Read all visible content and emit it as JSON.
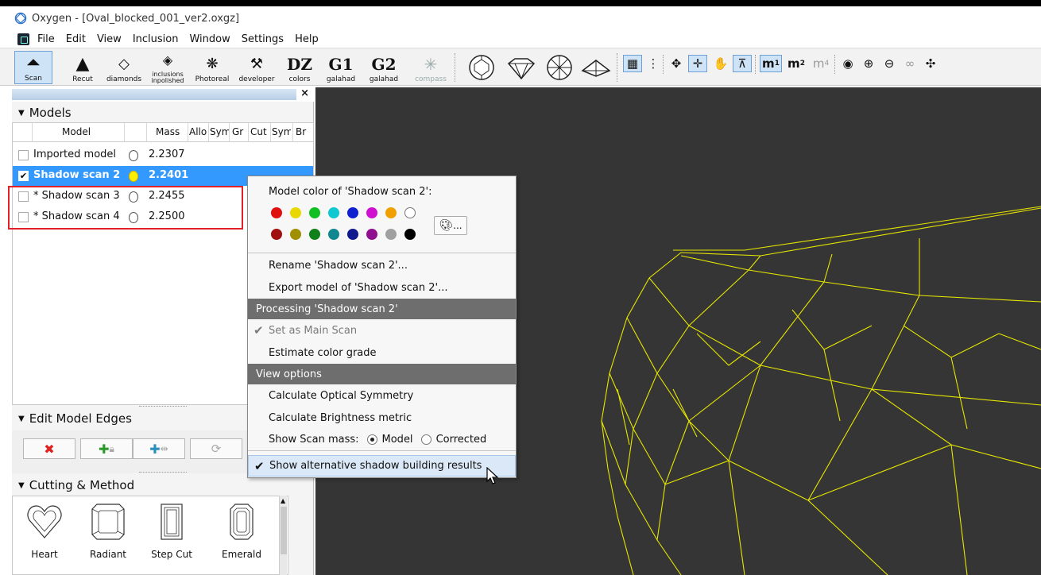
{
  "window": {
    "title": "Oxygen - [Oval_blocked_001_ver2.oxgz]"
  },
  "menu": [
    "File",
    "Edit",
    "View",
    "Inclusion",
    "Window",
    "Settings",
    "Help"
  ],
  "toolbar": {
    "main": [
      {
        "label": "Scan",
        "icon": "scan-icon",
        "active": true
      },
      {
        "label": "Recut",
        "icon": "recut-icon"
      },
      {
        "label": "diamonds",
        "icon": "diamonds-icon"
      },
      {
        "label": "inclusions inpolished",
        "icon": "inclusions-icon"
      },
      {
        "label": "Photoreal",
        "icon": "photoreal-icon"
      },
      {
        "label": "developer",
        "icon": "developer-icon"
      },
      {
        "label": "colors",
        "icon": "dz-colors-icon",
        "glyph": "DZ"
      },
      {
        "label": "galahad",
        "icon": "g1-galahad-icon",
        "glyph": "G1"
      },
      {
        "label": "galahad",
        "icon": "g2-galahad-icon",
        "glyph": "G2"
      },
      {
        "label": "compass",
        "icon": "compass-icon"
      }
    ],
    "subscript_labels": {
      "m1": "m",
      "m1_sub": "1",
      "m2": "m",
      "m2_sub": "2",
      "m4": "m",
      "m4_sub": "4"
    }
  },
  "models": {
    "header": "Models",
    "columns": [
      "Model",
      "Mass",
      "Allo",
      "Sym",
      "Gr",
      "Cut",
      "Sym",
      "Br"
    ],
    "rows": [
      {
        "name": "Imported model",
        "mass": "2.2307",
        "checked": false,
        "selected": false
      },
      {
        "name": "Shadow scan 2",
        "mass": "2.2401",
        "checked": true,
        "selected": true
      },
      {
        "name": "* Shadow scan 3",
        "mass": "2.2455",
        "checked": false,
        "selected": false
      },
      {
        "name": "* Shadow scan 4",
        "mass": "2.2500",
        "checked": false,
        "selected": false
      }
    ]
  },
  "edit_edges": {
    "header": "Edit Model Edges"
  },
  "cutting": {
    "header": "Cutting & Method",
    "shapes": [
      "Heart",
      "Radiant",
      "Step Cut",
      "Emerald"
    ]
  },
  "context_menu": {
    "color_title": "Model color of 'Shadow scan 2':",
    "colors_row1": [
      "#e01010",
      "#e8d800",
      "#10c020",
      "#10c8d0",
      "#1020d0",
      "#d010d0",
      "#f0a000",
      "#ffffff"
    ],
    "colors_row2": [
      "#a01010",
      "#a09000",
      "#108018",
      "#108890",
      "#101890",
      "#901090",
      "#a0a0a0",
      "#000000"
    ],
    "palette_more": "...",
    "rename": "Rename 'Shadow scan 2'...",
    "export": "Export model of 'Shadow scan 2'...",
    "processing_section": "Processing 'Shadow scan 2'",
    "set_main": "Set as Main Scan",
    "estimate": "Estimate color grade",
    "view_section": "View options",
    "optical_sym": "Calculate Optical Symmetry",
    "brightness": "Calculate Brightness metric",
    "scan_mass_label": "Show Scan mass:",
    "scan_mass_model": "Model",
    "scan_mass_corrected": "Corrected",
    "scan_mass_selected": "Model",
    "alt_shadow": "Show alternative shadow building results"
  }
}
